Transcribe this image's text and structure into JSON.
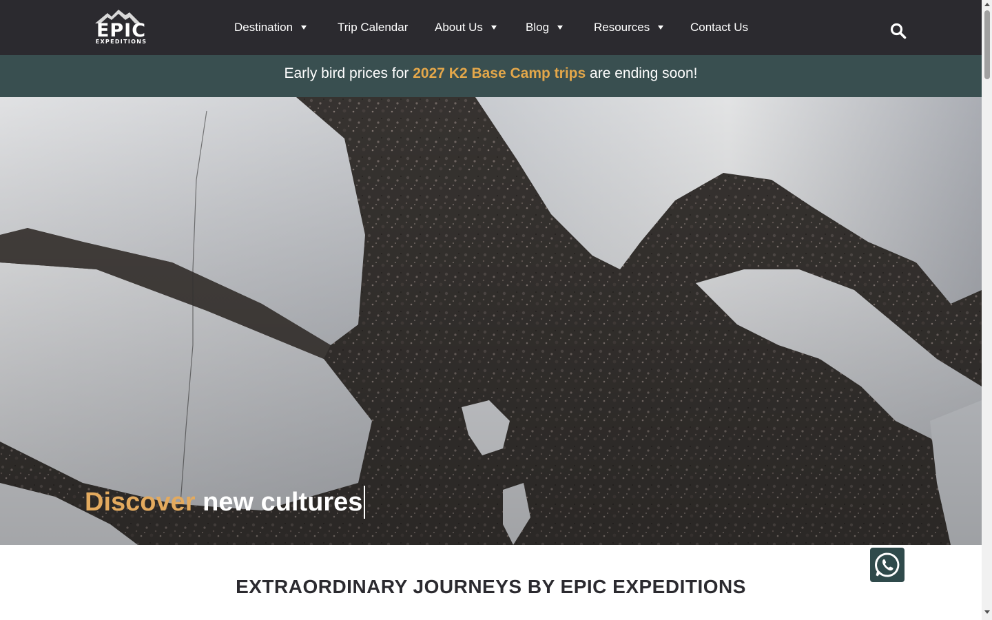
{
  "brand": {
    "logo_word": "EPIC",
    "logo_sub": "EXPEDITIONS"
  },
  "nav": {
    "items": [
      {
        "label": "Destination",
        "has_dropdown": true
      },
      {
        "label": "Trip Calendar",
        "has_dropdown": false
      },
      {
        "label": "About Us",
        "has_dropdown": true
      },
      {
        "label": "Blog",
        "has_dropdown": true
      },
      {
        "label": "Resources",
        "has_dropdown": true
      },
      {
        "label": "Contact Us",
        "has_dropdown": false
      }
    ],
    "search_icon": "search-icon"
  },
  "promo": {
    "before": "Early bird prices for ",
    "link": "2027 K2 Base Camp trips",
    "after": " are ending soon!"
  },
  "hero": {
    "accent_word": "Discover",
    "rest_text": " new cultures"
  },
  "section": {
    "title": "EXTRAORDINARY JOURNEYS BY EPIC EXPEDITIONS"
  },
  "whatsapp": {
    "icon": "whatsapp-icon"
  },
  "colors": {
    "header_bg": "#2b2a2f",
    "promo_bg": "#394f50",
    "accent": "#e3a74a",
    "whatsapp_bg": "#2f4a4b"
  }
}
